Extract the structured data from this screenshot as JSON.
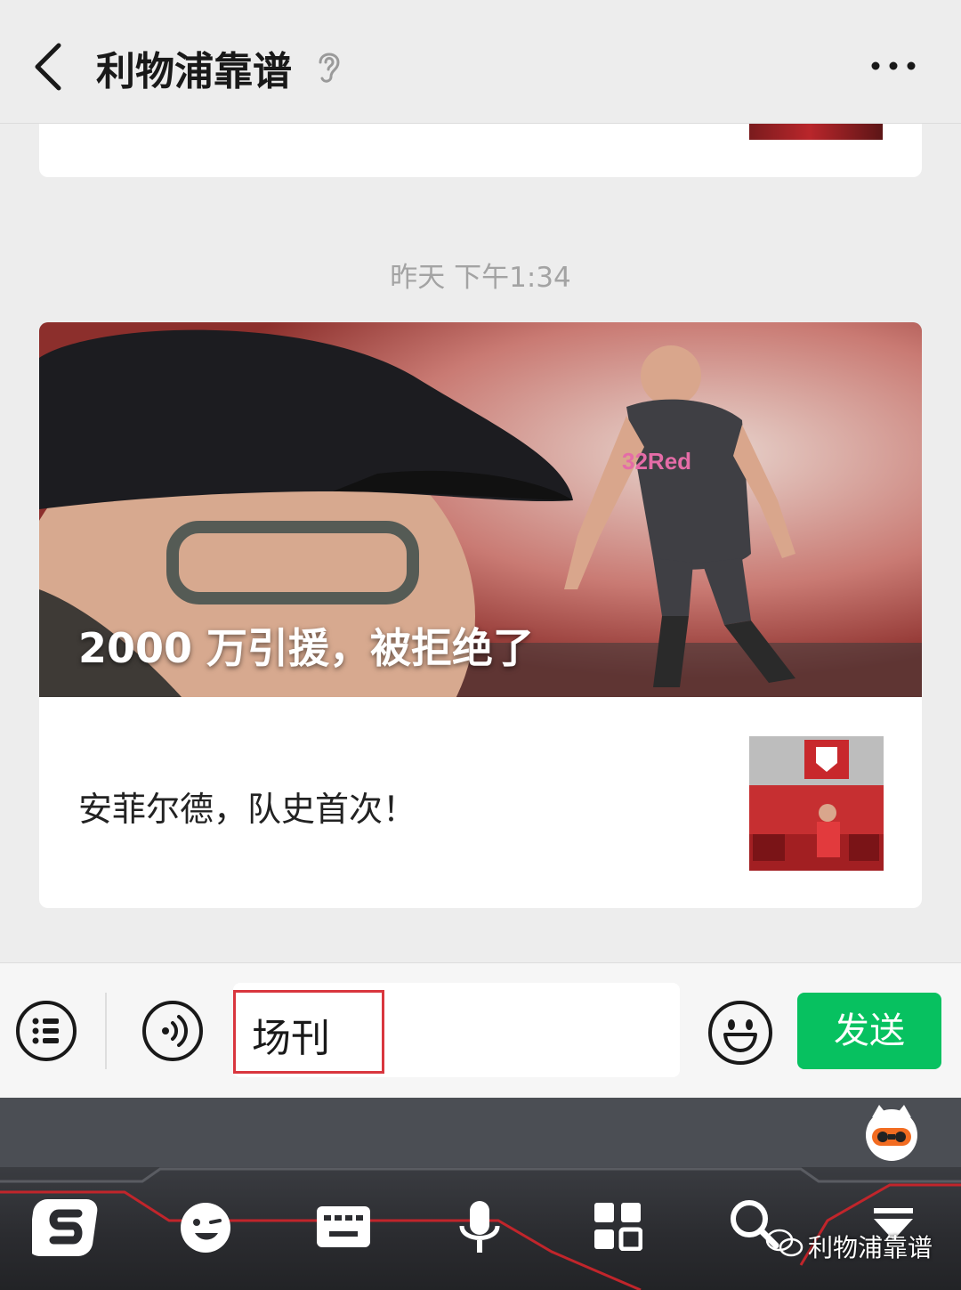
{
  "header": {
    "title": "利物浦靠谱"
  },
  "chat": {
    "timestamp": "昨天 下午1:34",
    "article": {
      "cover_title": "2000 万引援，被拒绝了",
      "sub_title": "安菲尔德，队史首次！"
    }
  },
  "input_bar": {
    "input_value": "场刊",
    "send_label": "发送"
  },
  "keyboard": {
    "watermark_text": "利物浦靠谱"
  },
  "colors": {
    "send_green": "#07c160",
    "highlight_red": "#d9363e",
    "background": "#ededed"
  }
}
